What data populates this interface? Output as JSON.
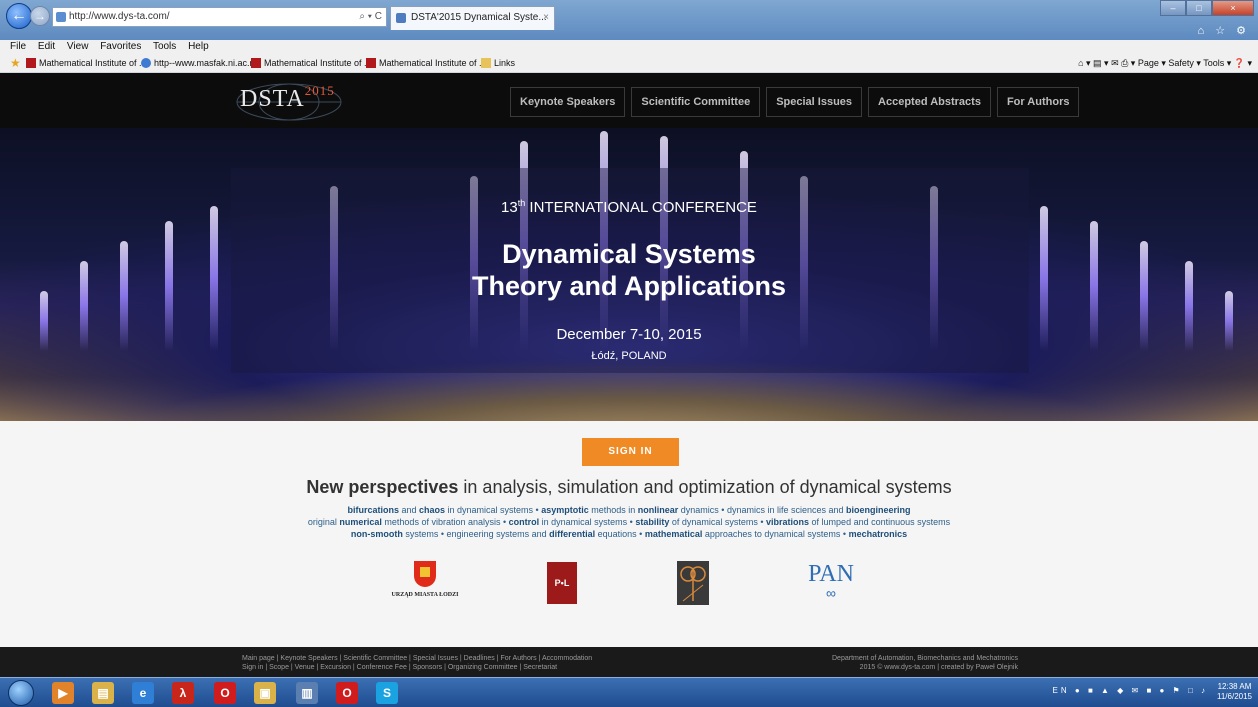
{
  "browser": {
    "url": "http://www.dys-ta.com/",
    "addr_actions": "⌕ ▾ C",
    "tab_title": "DSTA'2015 Dynamical Syste...",
    "tab_close": "×",
    "back_glyph": "←",
    "forward_glyph": "→",
    "window_min": "–",
    "window_max": "□",
    "window_close": "×",
    "right_icons": "⌂ ☆ ⚙",
    "menu": [
      "File",
      "Edit",
      "View",
      "Favorites",
      "Tools",
      "Help"
    ],
    "favorites": [
      {
        "label": "Mathematical Institute of ...",
        "icon": "institute-icon"
      },
      {
        "label": "http--www.masfak.ni.ac.r...",
        "icon": "ie-page-icon"
      },
      {
        "label": "Mathematical Institute of ...",
        "icon": "institute-icon"
      },
      {
        "label": "Mathematical Institute of ...",
        "icon": "institute-icon"
      },
      {
        "label": "Links",
        "icon": "folder-icon"
      }
    ],
    "favorites_star": "★",
    "command_bar": "⌂ ▾  ▤ ▾ ✉  ⎙ ▾  Page ▾  Safety ▾  Tools ▾  ❓ ▾"
  },
  "site": {
    "logo_text": "DSTA",
    "logo_year": "2015",
    "nav": [
      "Keynote Speakers",
      "Scientific Committee",
      "Special Issues",
      "Accepted Abstracts",
      "For Authors"
    ],
    "hero": {
      "ordinal_num": "13",
      "ordinal_sup": "th",
      "subtitle": " INTERNATIONAL CONFERENCE",
      "title_line1": "Dynamical Systems",
      "title_line2": "Theory and Applications",
      "date": "December 7-10, 2015",
      "place": "Łódź, POLAND"
    },
    "signin_label": "SIGN IN",
    "tagline_bold": "New perspectives",
    "tagline_rest": " in analysis, simulation and optimization of dynamical systems",
    "topic_lines": [
      [
        [
          "b",
          "bifurcations"
        ],
        [
          "t",
          " and "
        ],
        [
          "b",
          "chaos"
        ],
        [
          "t",
          " in dynamical systems • "
        ],
        [
          "b",
          "asymptotic"
        ],
        [
          "t",
          " methods in "
        ],
        [
          "b",
          "nonlinear"
        ],
        [
          "t",
          " dynamics • dynamics in life sciences and "
        ],
        [
          "b",
          "bioengineering"
        ]
      ],
      [
        [
          "t",
          "original "
        ],
        [
          "b",
          "numerical"
        ],
        [
          "t",
          " methods of vibration analysis • "
        ],
        [
          "b",
          "control"
        ],
        [
          "t",
          " in dynamical systems • "
        ],
        [
          "b",
          "stability"
        ],
        [
          "t",
          " of dynamical systems • "
        ],
        [
          "b",
          "vibrations"
        ],
        [
          "t",
          " of lumped and continuous systems"
        ]
      ],
      [
        [
          "b",
          "non-smooth"
        ],
        [
          "t",
          " systems • engineering systems and "
        ],
        [
          "b",
          "differential"
        ],
        [
          "t",
          " equations • "
        ],
        [
          "b",
          "mathematical"
        ],
        [
          "t",
          " approaches to dynamical systems • "
        ],
        [
          "b",
          "mechatronics"
        ]
      ]
    ],
    "partners": {
      "lodz_text": "URZĄD MIASTA ŁODZI",
      "pl_text": "P•L",
      "pan_text": "PAN",
      "pan_wave": "∞"
    },
    "footer": {
      "left_line1": "Main page | Keynote Speakers | Scientific Committee | Special Issues | Deadlines | For Authors | Accommodation",
      "left_line2": "Sign in | Scope | Venue | Excursion | Conference Fee | Sponsors | Organizing Committee | Secretariat",
      "right_line1": "Department of Automation, Biomechanics and Mechatronics",
      "right_line2": "2015 © www.dys-ta.com | created by Paweł Olejnik"
    }
  },
  "taskbar": {
    "apps": [
      {
        "name": "media-player-icon",
        "glyph": "▶",
        "color": "#e0832a"
      },
      {
        "name": "file-explorer-icon",
        "glyph": "▤",
        "color": "#d9b24a"
      },
      {
        "name": "internet-explorer-icon",
        "glyph": "e",
        "color": "#2f7fd6"
      },
      {
        "name": "acrobat-icon",
        "glyph": "λ",
        "color": "#c8261b"
      },
      {
        "name": "opera-icon",
        "glyph": "O",
        "color": "#d01c1c"
      },
      {
        "name": "folder-icon",
        "glyph": "▣",
        "color": "#d9b24a"
      },
      {
        "name": "document-icon",
        "glyph": "▥",
        "color": "#5a7fb0"
      },
      {
        "name": "opera-icon-2",
        "glyph": "O",
        "color": "#d01c1c"
      },
      {
        "name": "skype-icon",
        "glyph": "S",
        "color": "#1aa3e0"
      }
    ],
    "lang": "EN",
    "tray_icons": "● ■ ▲ ◆ ✉ ■ ● ⚑ □ ♪",
    "time": "12:38 AM",
    "date": "11/6/2015"
  }
}
